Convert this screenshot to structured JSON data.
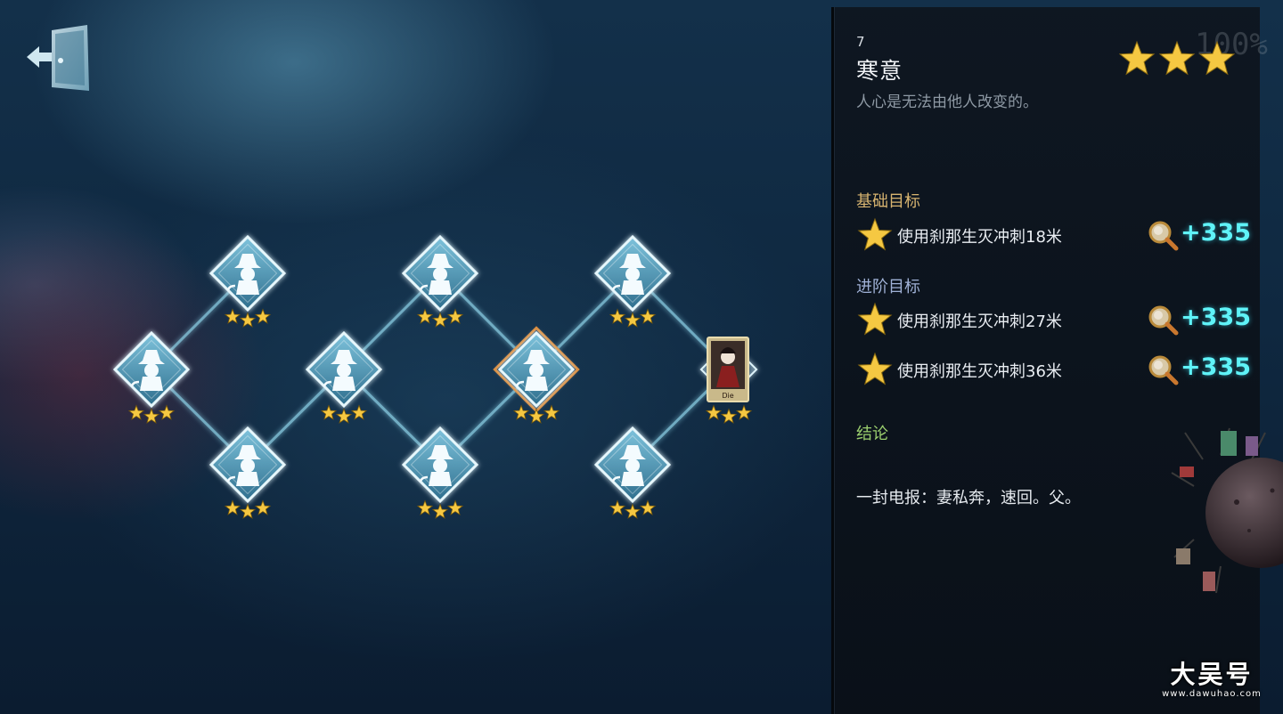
{
  "level": {
    "number": "7",
    "title": "寒意",
    "description": "人心是无法由他人改变的。",
    "stars_earned": 3,
    "stars_total": 3
  },
  "objectives": {
    "basic_label": "基础目标",
    "advanced_label": "进阶目标",
    "basic": [
      {
        "text": "使用刹那生灭冲刺18米",
        "reward": "+335"
      }
    ],
    "advanced": [
      {
        "text": "使用刹那生灭冲刺27米",
        "reward": "+335"
      },
      {
        "text": "使用刹那生灭冲刺36米",
        "reward": "+335"
      }
    ]
  },
  "conclusion": {
    "label": "结论",
    "text": "一封电报：妻私奔，速回。父。"
  },
  "map": {
    "nodes": [
      {
        "id": "n1",
        "stars": 3,
        "type": "detective"
      },
      {
        "id": "n2",
        "stars": 3,
        "type": "detective"
      },
      {
        "id": "n3",
        "stars": 3,
        "type": "detective"
      },
      {
        "id": "n4",
        "stars": 3,
        "type": "detective"
      },
      {
        "id": "n5",
        "stars": 3,
        "type": "detective"
      },
      {
        "id": "n6",
        "stars": 3,
        "type": "detective"
      },
      {
        "id": "n7",
        "stars": 3,
        "type": "detective",
        "selected": true
      },
      {
        "id": "n8",
        "stars": 3,
        "type": "detective"
      },
      {
        "id": "n9",
        "stars": 3,
        "type": "detective"
      },
      {
        "id": "n10",
        "stars": 3,
        "type": "character-card"
      }
    ],
    "character_card_label": "Die"
  },
  "watermark": {
    "main": "大吴号",
    "sub": "www.dawuhao.com"
  },
  "colors": {
    "reward": "#5ff3f8",
    "basic_label": "#d7b470",
    "advanced_label": "#9fb1d6",
    "conclusion_label": "#9bcf6e",
    "star": "#f5c842",
    "selected_border": "#d98a3a"
  },
  "icons": {
    "exit": "exit-door-icon",
    "node": "detective-silhouette-icon",
    "clue": "magnifier-icon",
    "star": "star-icon"
  }
}
